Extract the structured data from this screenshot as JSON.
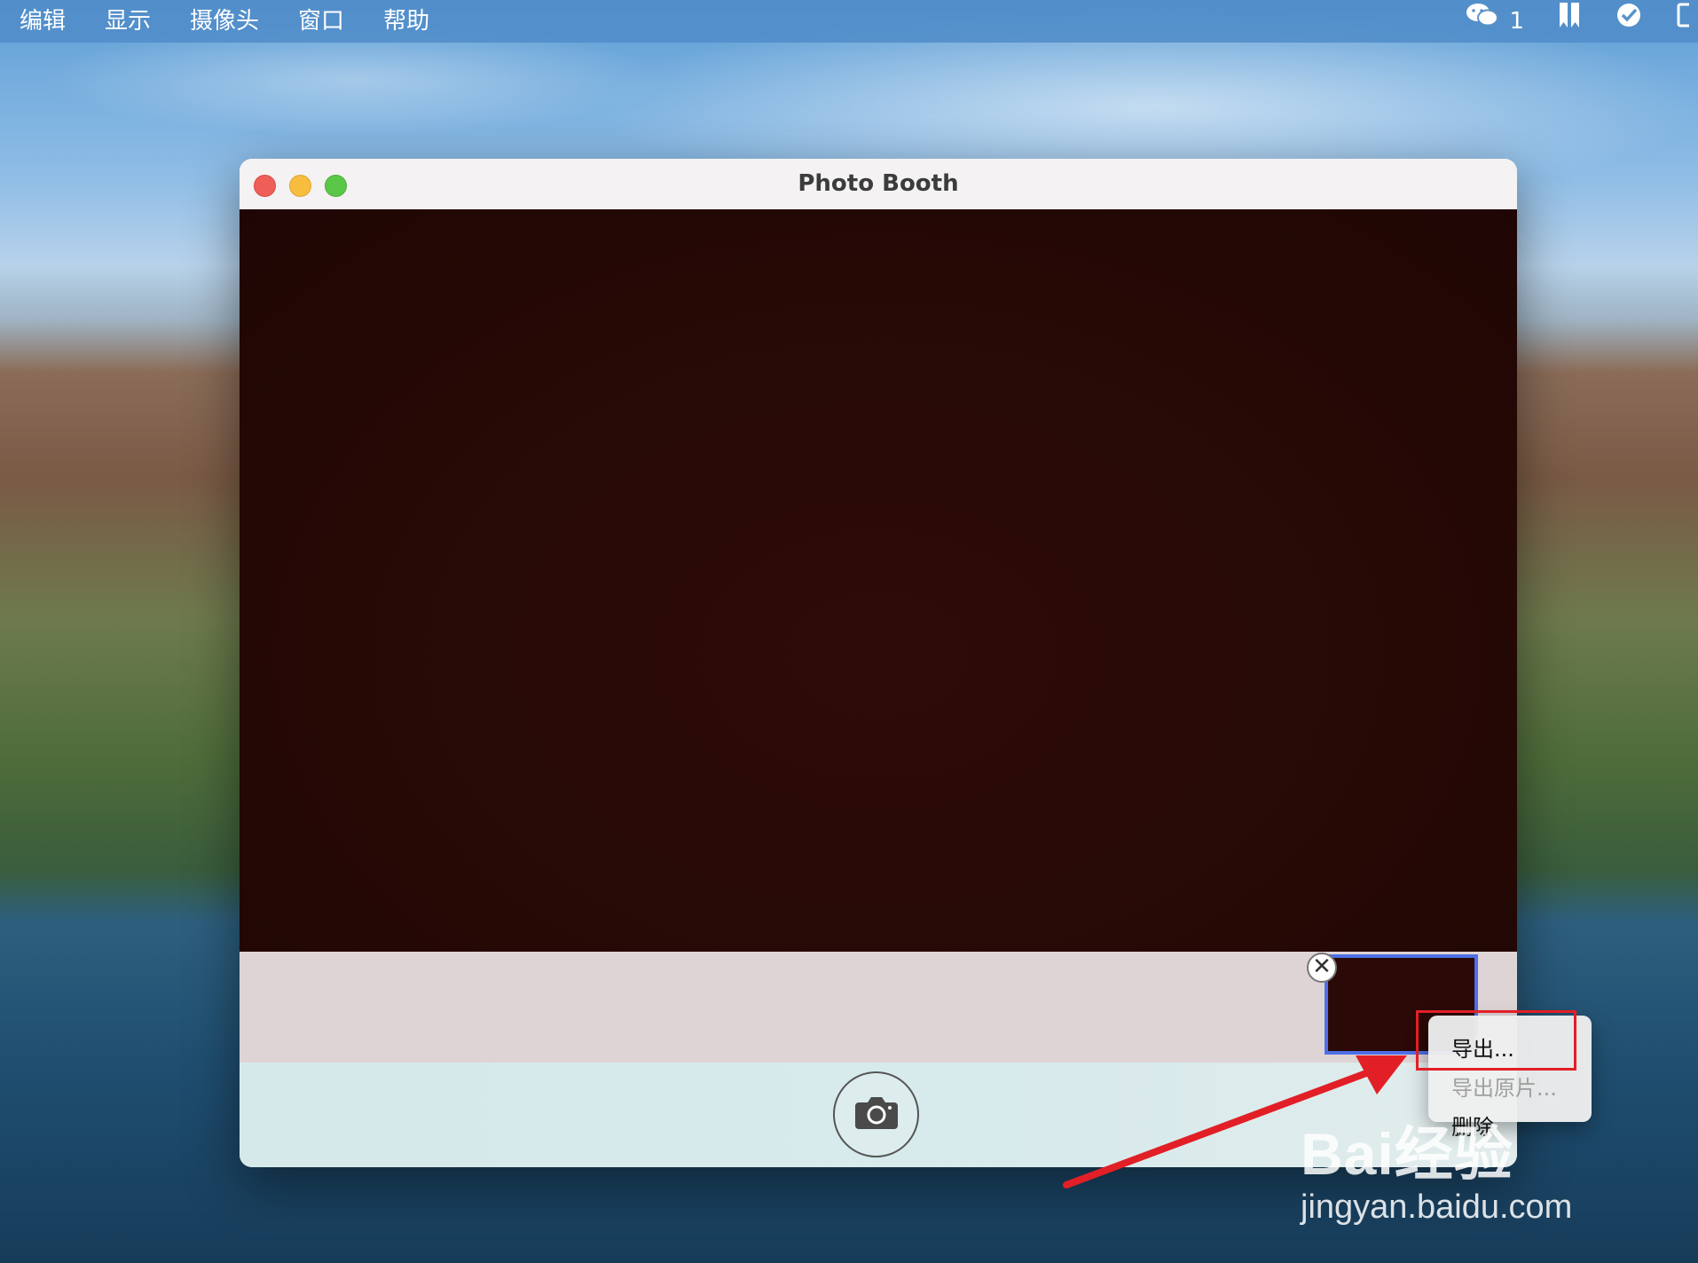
{
  "menubar": {
    "items": [
      "编辑",
      "显示",
      "摄像头",
      "窗口",
      "帮助"
    ],
    "status": {
      "wechat_icon": "wechat-icon",
      "wechat_count": "1",
      "bookmark_icon": "bookmark-icon",
      "check_icon": "check-circle-icon"
    }
  },
  "window": {
    "title": "Photo Booth",
    "traffic_lights": [
      "close",
      "minimize",
      "maximize"
    ]
  },
  "thumbnail": {
    "remove_icon": "close-icon",
    "remove_glyph": "✕"
  },
  "shutter": {
    "icon": "camera-icon"
  },
  "context_menu": {
    "items": [
      {
        "label": "导出...",
        "enabled": true
      },
      {
        "label": "导出原片...",
        "enabled": false
      },
      {
        "label": "删除",
        "enabled": true
      }
    ]
  },
  "annotation": {
    "highlight_color": "#e21f26",
    "arrow_color": "#e21f26"
  },
  "watermark": {
    "brand": "Bai经验",
    "url": "jingyan.baidu.com"
  }
}
